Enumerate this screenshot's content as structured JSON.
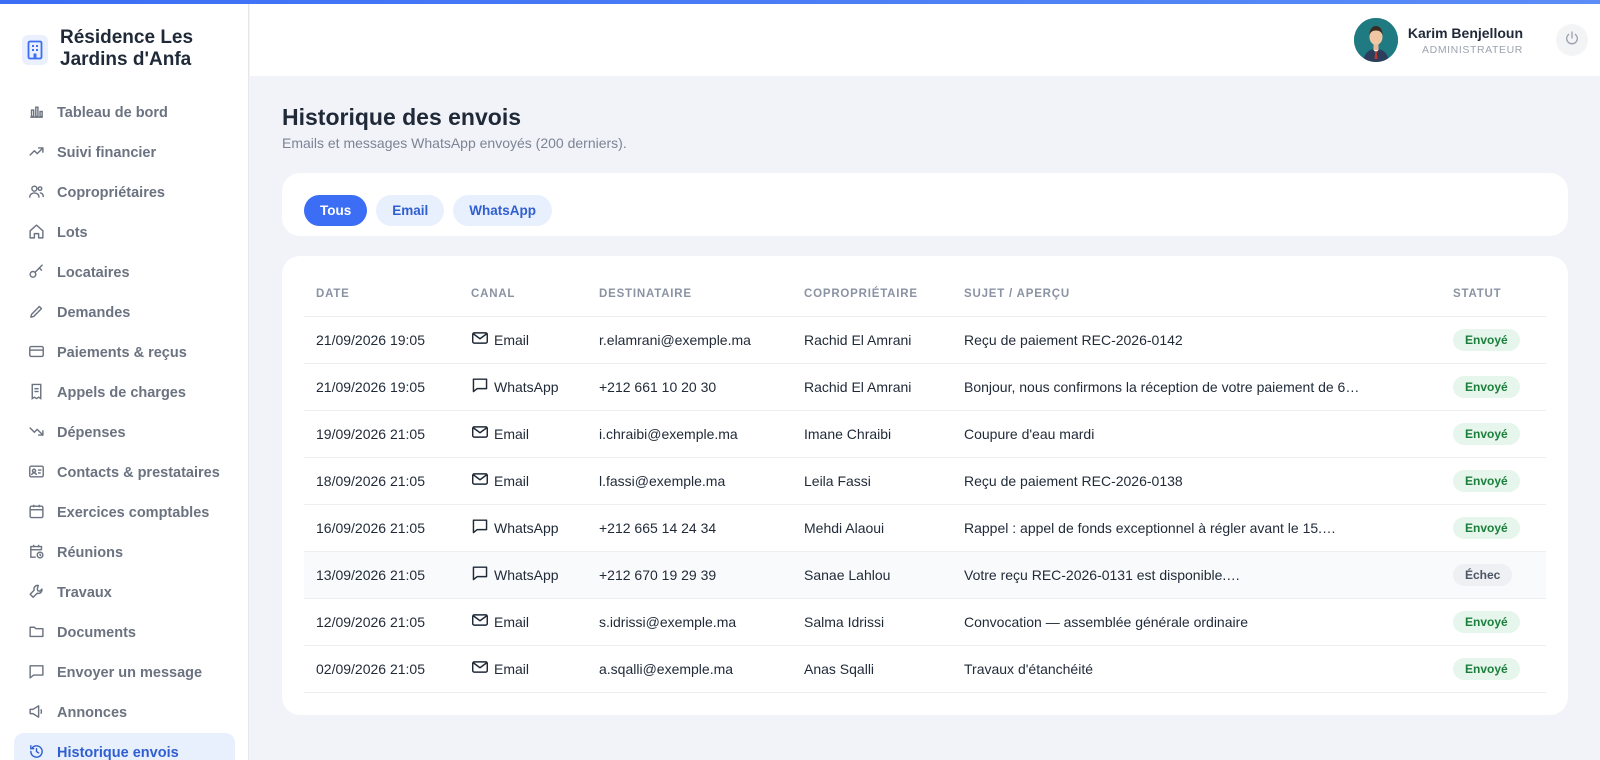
{
  "brand": {
    "name": "Résidence Les Jardins d'Anfa",
    "icon": "building-icon"
  },
  "sidebar": {
    "items": [
      {
        "label": "Tableau de bord",
        "icon": "bar-chart-icon"
      },
      {
        "label": "Suivi financier",
        "icon": "trending-up-icon"
      },
      {
        "label": "Copropriétaires",
        "icon": "users-icon"
      },
      {
        "label": "Lots",
        "icon": "home-icon"
      },
      {
        "label": "Locataires",
        "icon": "key-icon"
      },
      {
        "label": "Demandes",
        "icon": "pencil-icon"
      },
      {
        "label": "Paiements & reçus",
        "icon": "credit-card-icon"
      },
      {
        "label": "Appels de charges",
        "icon": "receipt-icon"
      },
      {
        "label": "Dépenses",
        "icon": "trending-down-icon"
      },
      {
        "label": "Contacts & prestataires",
        "icon": "contact-card-icon"
      },
      {
        "label": "Exercices comptables",
        "icon": "calendar-icon"
      },
      {
        "label": "Réunions",
        "icon": "calendar-clock-icon"
      },
      {
        "label": "Travaux",
        "icon": "wrench-icon"
      },
      {
        "label": "Documents",
        "icon": "folder-icon"
      },
      {
        "label": "Envoyer un message",
        "icon": "message-icon"
      },
      {
        "label": "Annonces",
        "icon": "megaphone-icon"
      },
      {
        "label": "Historique envois",
        "icon": "history-icon",
        "active": true
      }
    ]
  },
  "header": {
    "user_name": "Karim Benjelloun",
    "user_role": "ADMINISTRATEUR"
  },
  "main": {
    "title": "Historique des envois",
    "subtitle": "Emails et messages WhatsApp envoyés (200 derniers).",
    "filters": [
      {
        "label": "Tous",
        "active": true
      },
      {
        "label": "Email"
      },
      {
        "label": "WhatsApp"
      }
    ],
    "table": {
      "columns": [
        "DATE",
        "CANAL",
        "DESTINATAIRE",
        "COPROPRIÉTAIRE",
        "SUJET / APERÇU",
        "STATUT"
      ],
      "rows": [
        {
          "date": "21/09/2026 19:05",
          "canal": "Email",
          "destinataire": "r.elamrani@exemple.ma",
          "coproprietaire": "Rachid El Amrani",
          "sujet": "Reçu de paiement REC-2026-0142",
          "statut": "Envoyé"
        },
        {
          "date": "21/09/2026 19:05",
          "canal": "WhatsApp",
          "destinataire": "+212 661 10 20 30",
          "coproprietaire": "Rachid El Amrani",
          "sujet": "Bonjour, nous confirmons la réception de votre paiement de 6…",
          "statut": "Envoyé"
        },
        {
          "date": "19/09/2026 21:05",
          "canal": "Email",
          "destinataire": "i.chraibi@exemple.ma",
          "coproprietaire": "Imane Chraibi",
          "sujet": "Coupure d'eau mardi",
          "statut": "Envoyé"
        },
        {
          "date": "18/09/2026 21:05",
          "canal": "Email",
          "destinataire": "l.fassi@exemple.ma",
          "coproprietaire": "Leila Fassi",
          "sujet": "Reçu de paiement REC-2026-0138",
          "statut": "Envoyé"
        },
        {
          "date": "16/09/2026 21:05",
          "canal": "WhatsApp",
          "destinataire": "+212 665 14 24 34",
          "coproprietaire": "Mehdi Alaoui",
          "sujet": "Rappel : appel de fonds exceptionnel à régler avant le 15.…",
          "statut": "Envoyé"
        },
        {
          "date": "13/09/2026 21:05",
          "canal": "WhatsApp",
          "destinataire": "+212 670 19 29 39",
          "coproprietaire": "Sanae Lahlou",
          "sujet": "Votre reçu REC-2026-0131 est disponible.…",
          "statut": "Échec"
        },
        {
          "date": "12/09/2026 21:05",
          "canal": "Email",
          "destinataire": "s.idrissi@exemple.ma",
          "coproprietaire": "Salma Idrissi",
          "sujet": "Convocation — assemblée générale ordinaire",
          "statut": "Envoyé"
        },
        {
          "date": "02/09/2026 21:05",
          "canal": "Email",
          "destinataire": "a.sqalli@exemple.ma",
          "coproprietaire": "Anas Sqalli",
          "sujet": "Travaux d'étanchéité",
          "statut": "Envoyé"
        }
      ]
    }
  },
  "colors": {
    "accent": "#3b6ef5",
    "success_bg": "#e6f6ec",
    "success_text": "#1b7f3b",
    "fail_bg": "#eef0f3"
  }
}
